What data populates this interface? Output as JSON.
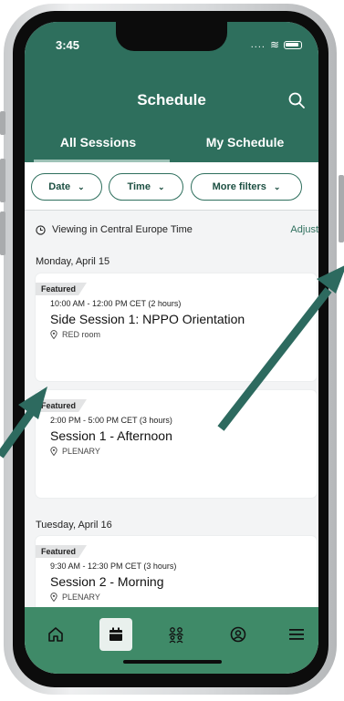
{
  "status_bar": {
    "time": "3:45",
    "signal": "....",
    "wifi_glyph": "≋"
  },
  "header": {
    "title": "Schedule"
  },
  "tabs": [
    {
      "label": "All Sessions",
      "active": true
    },
    {
      "label": "My Schedule",
      "active": false
    }
  ],
  "filters": [
    {
      "label": "Date",
      "chevron": "⌄"
    },
    {
      "label": "Time",
      "chevron": "⌄"
    },
    {
      "label": "More filters",
      "chevron": "⌄"
    }
  ],
  "timezone": {
    "text": "Viewing in Central Europe Time",
    "adjust_label": "Adjust"
  },
  "days": [
    {
      "label": "Monday, April 15"
    },
    {
      "label": "Tuesday, April 16"
    }
  ],
  "sessions": [
    {
      "tag": "Featured",
      "time": "10:00 AM - 12:00 PM CET (2 hours)",
      "title": "Side Session 1: NPPO Orientation",
      "location": "RED room"
    },
    {
      "tag": "Featured",
      "time": "2:00 PM - 5:00 PM CET (3 hours)",
      "title": "Session 1 - Afternoon",
      "location": "PLENARY"
    },
    {
      "tag": "Featured",
      "time": "9:30 AM - 12:30 PM CET (3 hours)",
      "title": "Session 2 - Morning",
      "location": "PLENARY"
    }
  ],
  "bottom_nav": [
    {
      "icon": "home-icon",
      "active": false
    },
    {
      "icon": "calendar-icon",
      "active": true
    },
    {
      "icon": "people-icon",
      "active": false
    },
    {
      "icon": "profile-icon",
      "active": false
    },
    {
      "icon": "menu-icon",
      "active": false
    }
  ],
  "colors": {
    "brand_green": "#2e6f5d",
    "nav_green": "#3f8a68",
    "arrow_teal": "#2d6a5f",
    "background": "#f3f4f5"
  }
}
